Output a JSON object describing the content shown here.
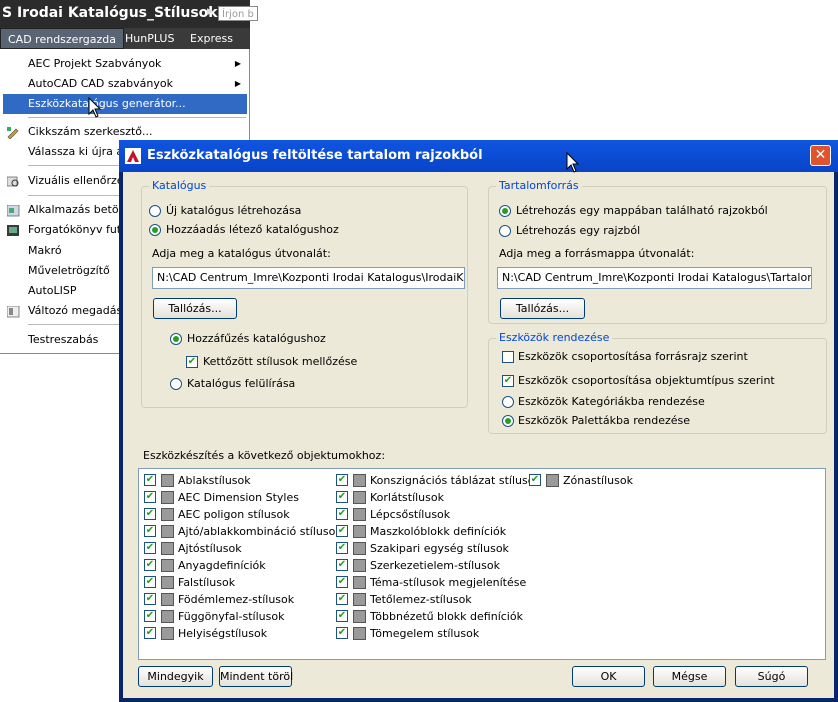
{
  "app": {
    "title": "S Irodai Katalógus_Stílusok.dwg",
    "search_placeholder": "Írjon b",
    "menubar": [
      "CAD rendszergazda",
      "HunPLUS",
      "Express"
    ],
    "menu_items": [
      {
        "label": "AEC Projekt Szabványok",
        "submenu": true
      },
      {
        "label": "AutoCAD CAD szabványok",
        "submenu": true
      },
      {
        "label": "Eszközkatalógus generátor...",
        "highlighted": true
      },
      {
        "label": "Cikkszám szerkesztő..."
      },
      {
        "label": "Válassza ki újra a g"
      },
      {
        "label": "Vizuális ellenőrzés"
      },
      {
        "label": "Alkalmazás betölt"
      },
      {
        "label": "Forgatókönyv futta"
      },
      {
        "label": "Makró"
      },
      {
        "label": "Műveletrögzítő"
      },
      {
        "label": "AutoLISP"
      },
      {
        "label": "Változó megadása"
      },
      {
        "label": "Testreszabás"
      }
    ]
  },
  "dialog": {
    "title": "Eszközkatalógus feltöltése tartalom rajzokból",
    "catalog": {
      "group_title": "Katalógus",
      "option_new": "Új katalógus létrehozása",
      "option_existing": "Hozzáadás létező katalógushoz",
      "path_label": "Adja meg a katalógus útvonalát:",
      "path_value": "N:\\CAD Centrum_Imre\\Kozponti Irodai Katalogus\\IrodaiKatalogus",
      "browse": "Tallózás...",
      "append": "Hozzáfűzés katalógushoz",
      "skip_duplicates": "Kettőzött stílusok mellőzése",
      "overwrite": "Katalógus felülírása"
    },
    "source": {
      "group_title": "Tartalomforrás",
      "option_folder": "Létrehozás egy mappában található rajzokból",
      "option_drawing": "Létrehozás egy rajzból",
      "path_label": "Adja meg a forrásmappa útvonalát:",
      "path_value": "N:\\CAD Centrum_Imre\\Kozponti Irodai Katalogus\\Tartalom",
      "browse": "Tallózás..."
    },
    "organize": {
      "group_title": "Eszközök rendezése",
      "by_source": "Eszközök csoportosítása forrásrajz szerint",
      "by_type": "Eszközök csoportosítása objektumtípus szerint",
      "to_categories": "Eszközök Kategóriákba rendezése",
      "to_palettes": "Eszközök Palettákba rendezése"
    },
    "objects_label": "Eszközkészítés a következő objektumokhoz:",
    "objects_col1": [
      "Ablakstílusok",
      "AEC Dimension Styles",
      "AEC poligon stílusok",
      "Ajtó/ablakkombináció stílusok",
      "Ajtóstílusok",
      "Anyagdefiníciók",
      "Falstílusok",
      "Födémlemez-stílusok",
      "Függönyfal-stílusok",
      "Helyiségstílusok"
    ],
    "objects_col2": [
      "Konszignációs táblázat stílusok",
      "Korlátstílusok",
      "Lépcsőstílusok",
      "Maszkolóblokk definíciók",
      "Szakipari egység stílusok",
      "Szerkezetielem-stílusok",
      "Téma-stílusok megjelenítése",
      "Tetőlemez-stílusok",
      "Többnézetű blokk definíciók",
      "Tömegelem stílusok"
    ],
    "objects_col3": [
      "Zónastílusok"
    ],
    "buttons": {
      "select_all": "Mindegyik",
      "clear_all": "Mindent töröl",
      "ok": "OK",
      "cancel": "Mégse",
      "help": "Súgó"
    }
  }
}
